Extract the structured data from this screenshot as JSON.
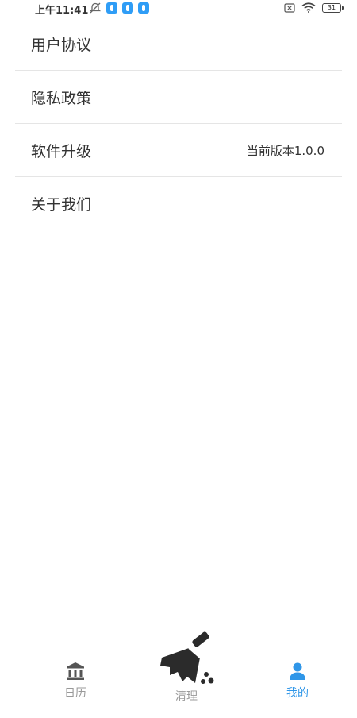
{
  "status_bar": {
    "time": "上午11:41",
    "battery": "31"
  },
  "menu": {
    "items": [
      {
        "label": "用户协议",
        "value": ""
      },
      {
        "label": "隐私政策",
        "value": ""
      },
      {
        "label": "软件升级",
        "value": "当前版本1.0.0"
      },
      {
        "label": "关于我们",
        "value": ""
      }
    ]
  },
  "tabs": {
    "items": [
      {
        "label": "日历",
        "icon": "bank-icon",
        "active": false
      },
      {
        "label": "清理",
        "icon": "broom-icon",
        "active": false
      },
      {
        "label": "我的",
        "icon": "user-icon",
        "active": true
      }
    ],
    "active_color": "#2f96e8",
    "inactive_color": "#999999"
  }
}
